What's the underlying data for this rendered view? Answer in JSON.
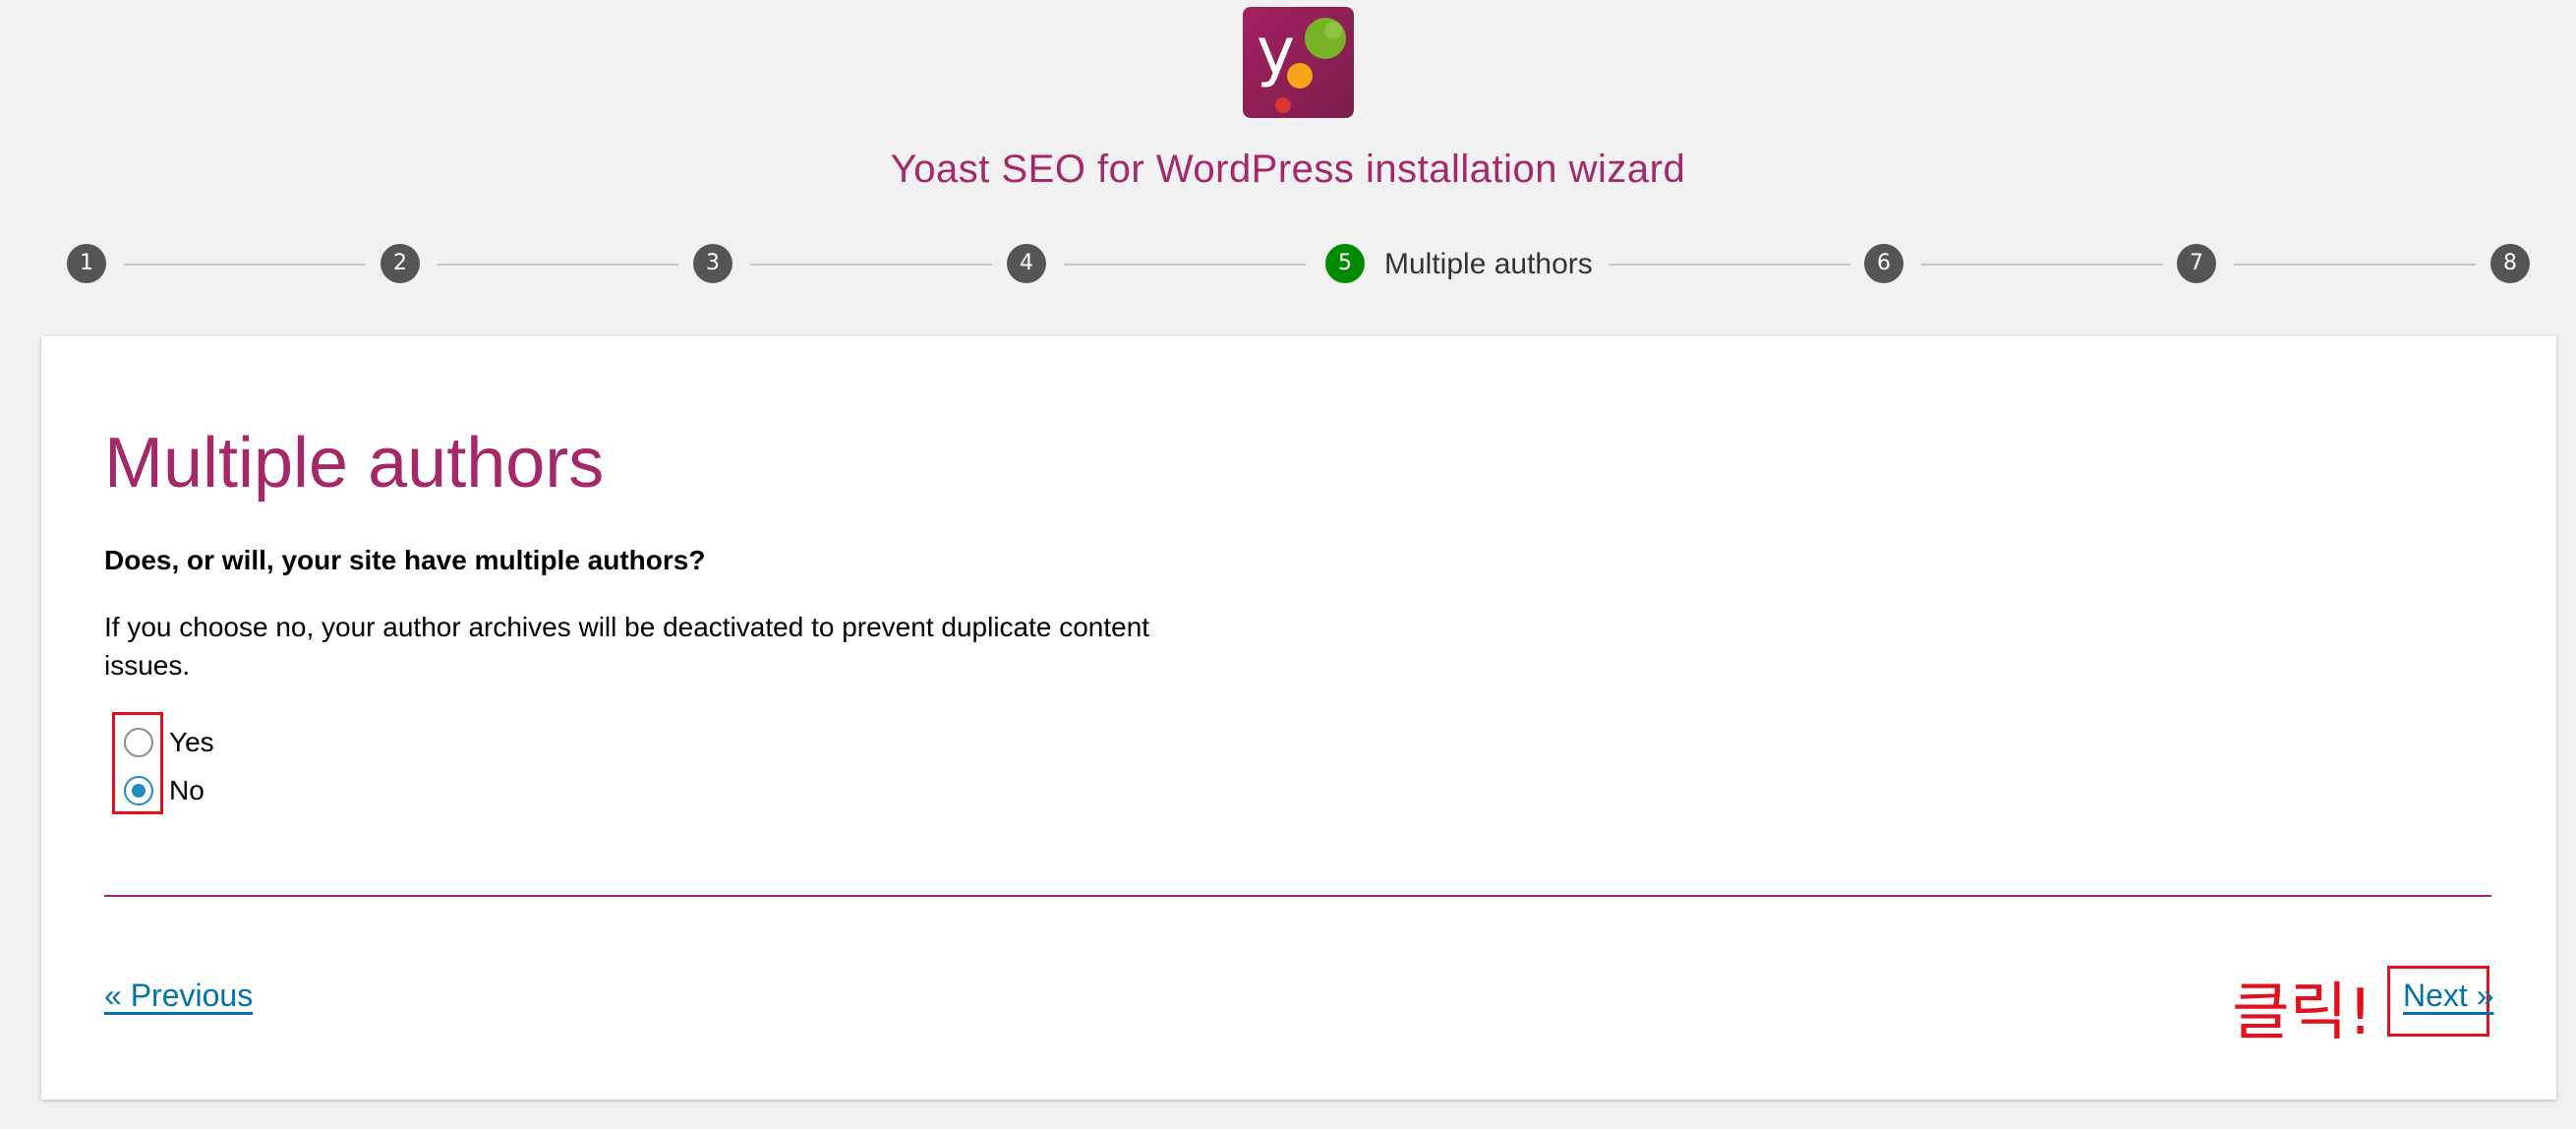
{
  "header": {
    "title": "Yoast SEO for WordPress installation wizard",
    "logo_icon": "yoast-logo-icon"
  },
  "stepper": {
    "steps": [
      {
        "number": "1"
      },
      {
        "number": "2"
      },
      {
        "number": "3"
      },
      {
        "number": "4"
      },
      {
        "number": "5",
        "label": "Multiple authors",
        "active": true
      },
      {
        "number": "6"
      },
      {
        "number": "7"
      },
      {
        "number": "8"
      }
    ],
    "active_color": "#008a00",
    "inactive_color": "#555555"
  },
  "main": {
    "title": "Multiple authors",
    "question": "Does, or will, your site have multiple authors?",
    "description": "If you choose no, your author archives will be deactivated to prevent duplicate content issues.",
    "options": [
      {
        "label": "Yes",
        "checked": false
      },
      {
        "label": "No",
        "checked": true
      }
    ]
  },
  "nav": {
    "previous_label": "« Previous",
    "next_label": "Next »"
  },
  "annotation": {
    "text": "클릭!",
    "color": "#e3101d"
  },
  "colors": {
    "brand": "#a4286a",
    "link": "#0073aa",
    "radio_checked": "#1e8cbe"
  }
}
